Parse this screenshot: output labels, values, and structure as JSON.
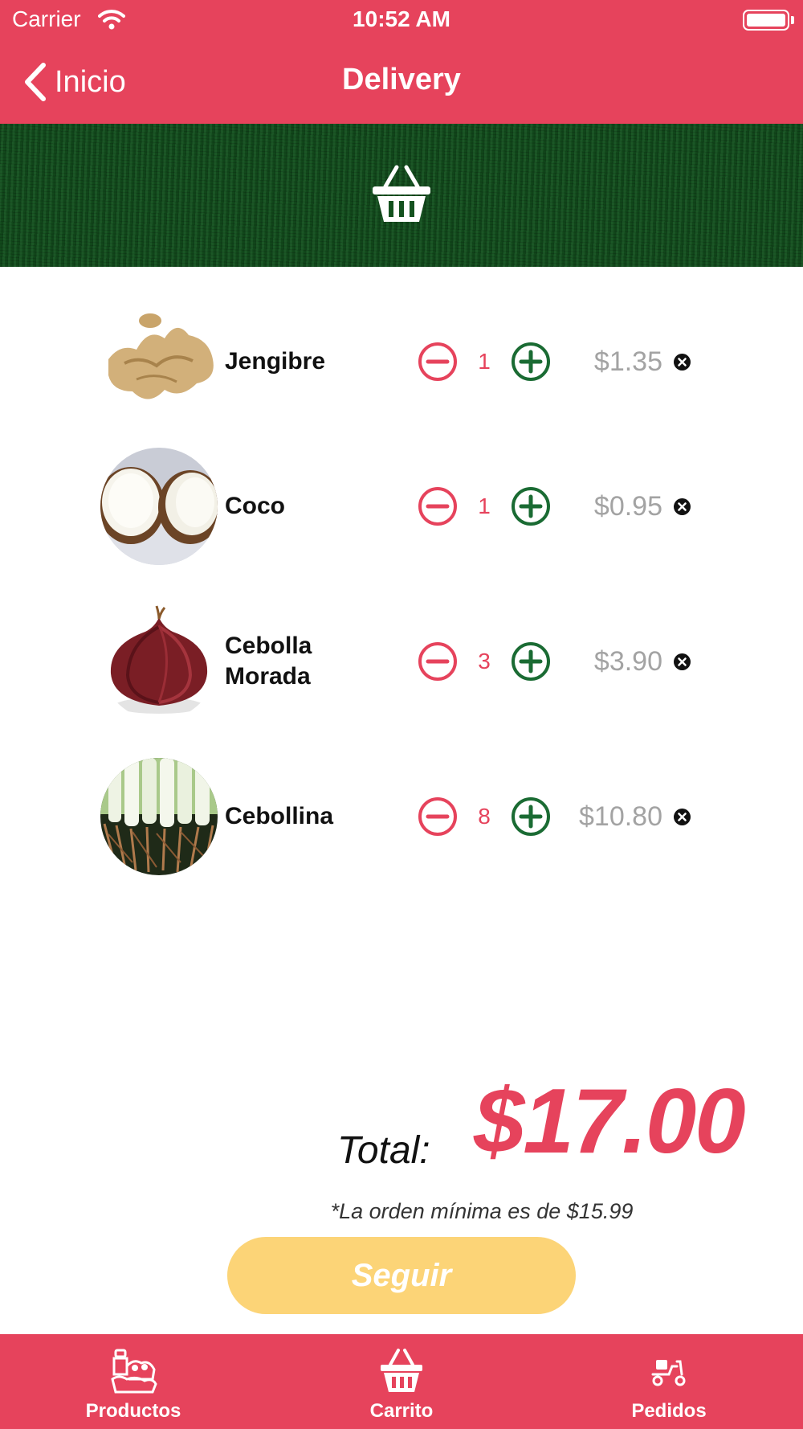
{
  "status_bar": {
    "carrier": "Carrier",
    "time": "10:52 AM"
  },
  "nav": {
    "back_label": "Inicio",
    "title": "Delivery"
  },
  "cart": {
    "items": [
      {
        "name": "Jengibre",
        "quantity": "1",
        "price": "$1.35"
      },
      {
        "name": "Coco",
        "quantity": "1",
        "price": "$0.95"
      },
      {
        "name": "Cebolla Morada",
        "quantity": "3",
        "price": "$3.90"
      },
      {
        "name": "Cebollina",
        "quantity": "8",
        "price": "$10.80"
      }
    ]
  },
  "summary": {
    "total_label": "Total:",
    "total_value": "$17.00",
    "minimum_note": "*La orden mínima es de $15.99",
    "continue_label": "Seguir"
  },
  "tabs": [
    {
      "label": "Productos",
      "icon": "groceries-icon"
    },
    {
      "label": "Carrito",
      "icon": "basket-icon"
    },
    {
      "label": "Pedidos",
      "icon": "delivery-scooter-icon"
    }
  ],
  "colors": {
    "brand": "#e6435c",
    "banner": "#14521f",
    "plus": "#1a6b33",
    "button": "#fcd477",
    "price": "#a3a3a3"
  }
}
